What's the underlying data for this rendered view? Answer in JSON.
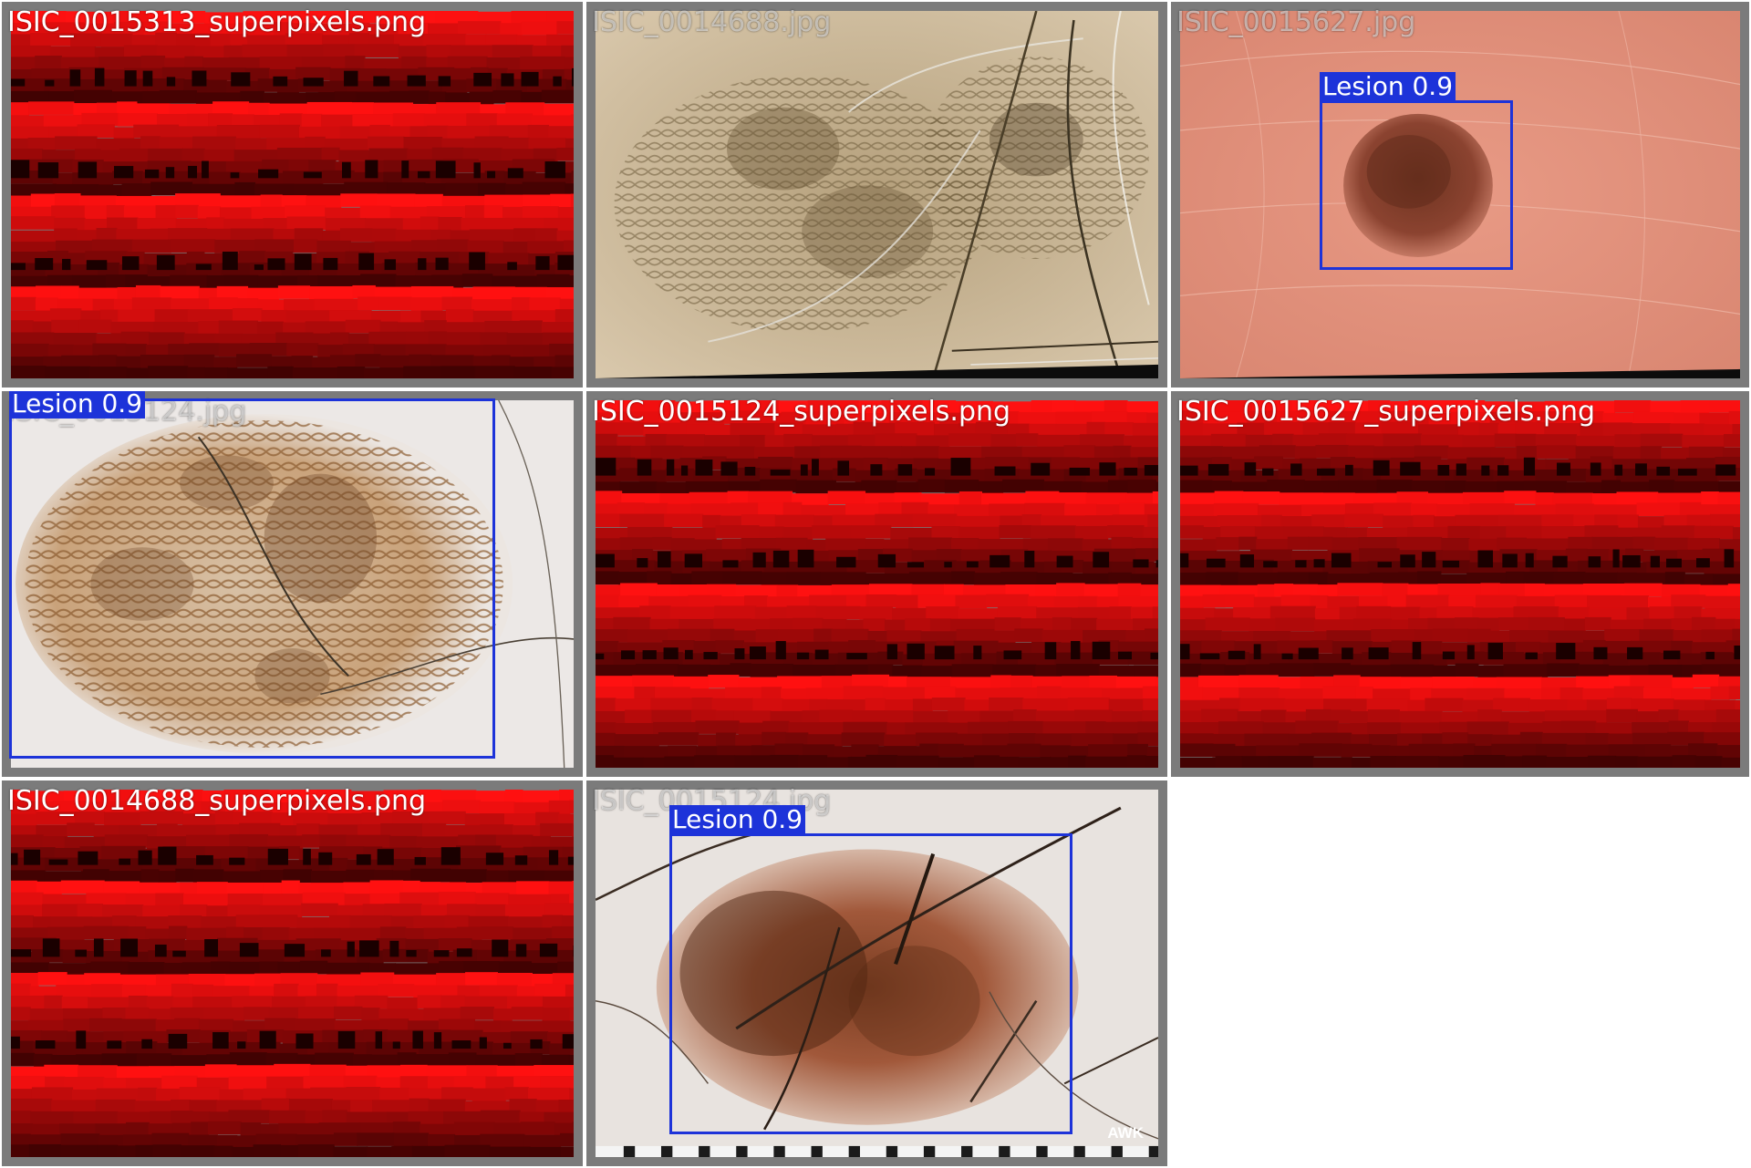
{
  "colors": {
    "tile_frame": "#7b7b7b",
    "detection_box": "#1d33d9",
    "superpixel_red": "#ff1010",
    "superpixel_dark": "#2a0000"
  },
  "tiles": [
    {
      "filename": "ISIC_0015313_superpixels.png",
      "kind": "superpixels"
    },
    {
      "filename": "ISIC_0014688.jpg",
      "kind": "dermoscopy-hairy-network"
    },
    {
      "filename": "ISIC_0015627.jpg",
      "kind": "dermoscopy-small-nevus",
      "detection": {
        "label": "Lesion 0.9",
        "confidence": 0.9
      }
    },
    {
      "filename": "ISIC_0015124.jpg",
      "kind": "dermoscopy-large-network",
      "detection": {
        "label": "Lesion 0.9",
        "confidence": 0.9
      }
    },
    {
      "filename": "ISIC_0015124_superpixels.png",
      "kind": "superpixels"
    },
    {
      "filename": "ISIC_0015627_superpixels.png",
      "kind": "superpixels"
    },
    {
      "filename": "ISIC_0014688_superpixels.png",
      "kind": "superpixels"
    },
    {
      "filename": "ISIC_0015124.jpg",
      "kind": "dermoscopy-hairy-lesion",
      "detection": {
        "label": "Lesion 0.9",
        "confidence": 0.9
      },
      "watermark": "AWK"
    }
  ]
}
